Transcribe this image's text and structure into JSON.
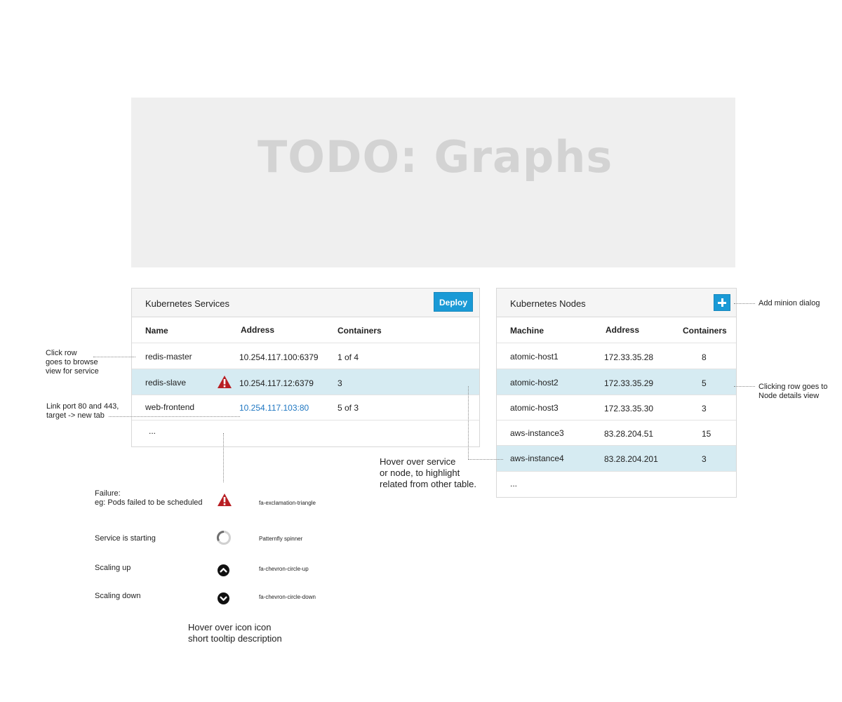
{
  "graphs": {
    "placeholder": "TODO: Graphs"
  },
  "services_panel": {
    "title": "Kubernetes Services",
    "deploy_label": "Deploy",
    "columns": [
      "Name",
      "Address",
      "Containers"
    ],
    "rows": [
      {
        "name": "redis-master",
        "address": "10.254.117.100:6379",
        "containers": "1 of 4"
      },
      {
        "name": "redis-slave",
        "address": "10.254.117.12:6379",
        "containers": "3"
      },
      {
        "name": "web-frontend",
        "address": "10.254.117.103:80",
        "containers": "5 of 3"
      }
    ],
    "more": "..."
  },
  "nodes_panel": {
    "title": "Kubernetes Nodes",
    "columns": [
      "Machine",
      "Address",
      "Containers"
    ],
    "rows": [
      {
        "machine": "atomic-host1",
        "address": "172.33.35.28",
        "containers": "8"
      },
      {
        "machine": "atomic-host2",
        "address": "172.33.35.29",
        "containers": "5"
      },
      {
        "machine": "atomic-host3",
        "address": "172.33.35.30",
        "containers": "3"
      },
      {
        "machine": "aws-instance3",
        "address": "83.28.204.51",
        "containers": "15"
      },
      {
        "machine": "aws-instance4",
        "address": "83.28.204.201",
        "containers": "3"
      }
    ],
    "more": "..."
  },
  "annotations": {
    "click_row": "Click row\ngoes to browse\nview for service",
    "link_port": "Link port 80 and 443,\ntarget -> new tab",
    "add_minion": "Add minion dialog",
    "clicking_row": "Clicking row goes to\nNode details view",
    "hover_service": "Hover over service\nor node, to highlight\nrelated from other table.",
    "hover_icon": "Hover over icon icon\nshort tooltip description"
  },
  "legend": [
    {
      "label": "Failure:\neg: Pods failed to be scheduled",
      "icon": "exclamation-triangle-icon",
      "icon_name": "fa-exclamation-triangle"
    },
    {
      "label": "Service is starting",
      "icon": "spinner-icon",
      "icon_name": "Patternfly spinner"
    },
    {
      "label": "Scaling up",
      "icon": "chevron-circle-up-icon",
      "icon_name": "fa-chevron-circle-up"
    },
    {
      "label": "Scaling down",
      "icon": "chevron-circle-down-icon",
      "icon_name": "fa-chevron-circle-down"
    }
  ],
  "colors": {
    "accent": "#1a9ad6",
    "highlight": "#d6ebf2",
    "danger": "#b81e23",
    "link": "#1f77c2"
  }
}
